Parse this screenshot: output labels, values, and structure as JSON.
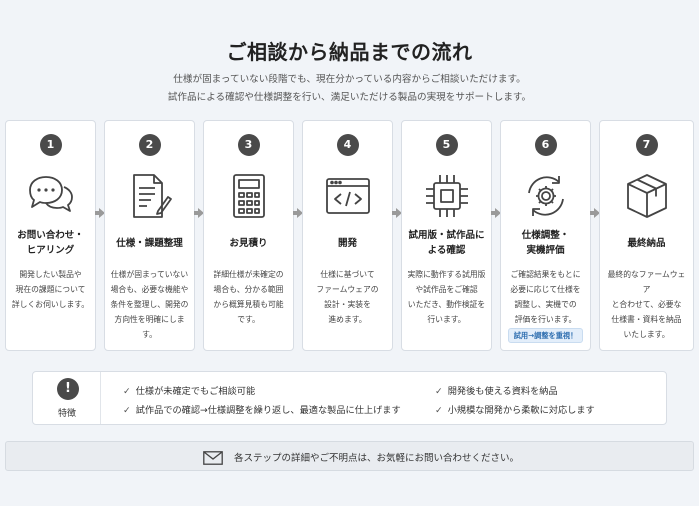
{
  "header": {
    "title": "ご相談から納品までの流れ",
    "subtitle_line1": "仕様が固まっていない段階でも、現在分かっている内容からご相談いただけます。",
    "subtitle_line2": "試作品による確認や仕様調整を行い、満足いただける製品の実現をサポートします。"
  },
  "steps": [
    {
      "num": "1",
      "icon": "chat-bubbles-icon",
      "title": "お問い合わせ・\nヒアリング",
      "desc": "開発したい製品や\n現在の課題について\n詳しくお伺いします。"
    },
    {
      "num": "2",
      "icon": "document-pen-icon",
      "title": "仕様・課題整理",
      "desc": "仕様が固まっていない\n場合も、必要な機能や\n条件を整理し、開発の\n方向性を明確にします。"
    },
    {
      "num": "3",
      "icon": "calculator-icon",
      "title": "お見積り",
      "desc": "詳細仕様が未確定の\n場合も、分かる範囲\nから概算見積も可能\nです。"
    },
    {
      "num": "4",
      "icon": "code-window-icon",
      "title": "開発",
      "desc": "仕様に基づいて\nファームウェアの\n設計・実装を\n進めます。"
    },
    {
      "num": "5",
      "icon": "chip-icon",
      "title": "試用版・試作品に\nよる確認",
      "desc": "実際に動作する試用版\nや試作品をご確認\nいただき、動作検証を\n行います。"
    },
    {
      "num": "6",
      "icon": "gear-cycle-icon",
      "title": "仕様調整・\n実機評価",
      "desc": "ご確認結果をもとに\n必要に応じて仕様を\n調整し、実機での\n評価を行います。",
      "tag": "試用→調整を重視！"
    },
    {
      "num": "7",
      "icon": "box-icon",
      "title": "最終納品",
      "desc": "最終的なファームウェア\nと合わせて、必要な\n仕様書・資料を納品\nいたします。"
    }
  ],
  "features": {
    "icon": "exclamation-icon",
    "label": "特徴",
    "items": [
      "仕様が未確定でもご相談可能",
      "試作品での確認→仕様調整を繰り返し、最適な製品に仕上げます",
      "開発後も使える資料を納品",
      "小規模な開発から柔軟に対応します"
    ]
  },
  "contact": {
    "icon": "envelope-icon",
    "text": "各ステップの詳細やご不明点は、お気軽にお問い合わせください。"
  }
}
